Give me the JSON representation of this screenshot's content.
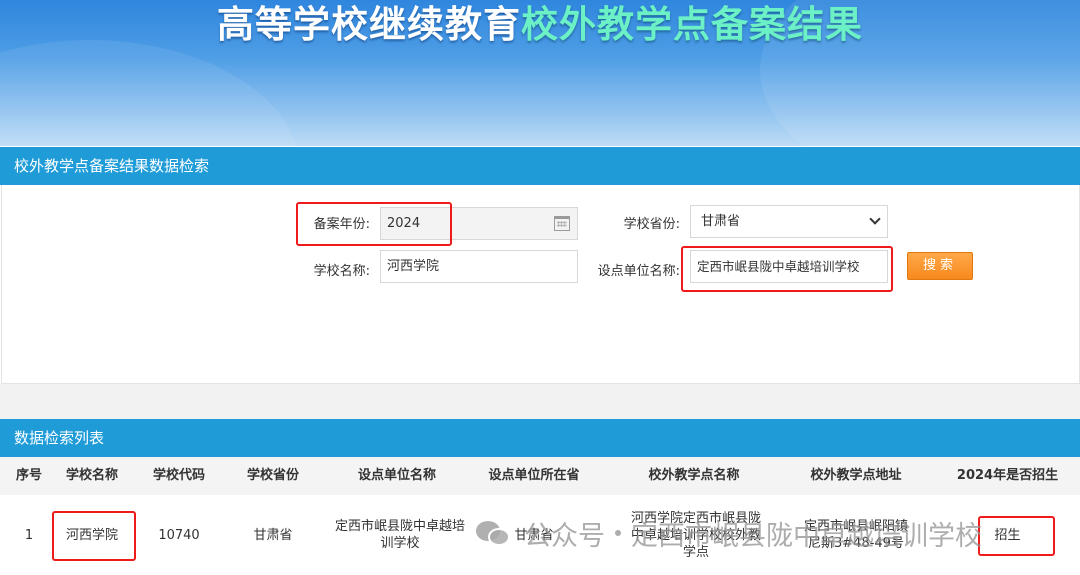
{
  "banner": {
    "title_part1": "高等学校继续教育",
    "title_part2": "校外教学点备案结果"
  },
  "search_panel": {
    "header": "校外教学点备案结果数据检索",
    "year_label": "备案年份:",
    "year_value": "2024",
    "province_label": "学校省份:",
    "province_value": "甘肃省",
    "school_label": "学校名称:",
    "school_value": "河西学院",
    "unit_label": "设点单位名称:",
    "unit_value": "定西市岷县陇中卓越培训学校",
    "search_button": "搜索"
  },
  "results": {
    "header": "数据检索列表",
    "columns": [
      "序号",
      "学校名称",
      "学校代码",
      "学校省份",
      "设点单位名称",
      "设点单位所在省",
      "校外教学点名称",
      "校外教学点地址",
      "2024年是否招生"
    ],
    "rows": [
      {
        "index": "1",
        "school": "河西学院",
        "code": "10740",
        "province": "甘肃省",
        "unit": "定西市岷县陇中卓越培训学校",
        "unit_province": "甘肃省",
        "point_name": "河西学院定西市岷县陇中卓越培训学校校外教学点",
        "address": "定西市岷县岷阳镇尼斯3#48-49号",
        "enrolling": "招生"
      }
    ]
  },
  "watermark": {
    "prefix": "公众号",
    "name": "定西市岷县陇中卓越培训学校"
  },
  "colors": {
    "header_bar": "#1f9cd8",
    "search_button": "#f7891d",
    "highlight": "#ef1b1b",
    "title_accent": "#6cf0c6"
  }
}
